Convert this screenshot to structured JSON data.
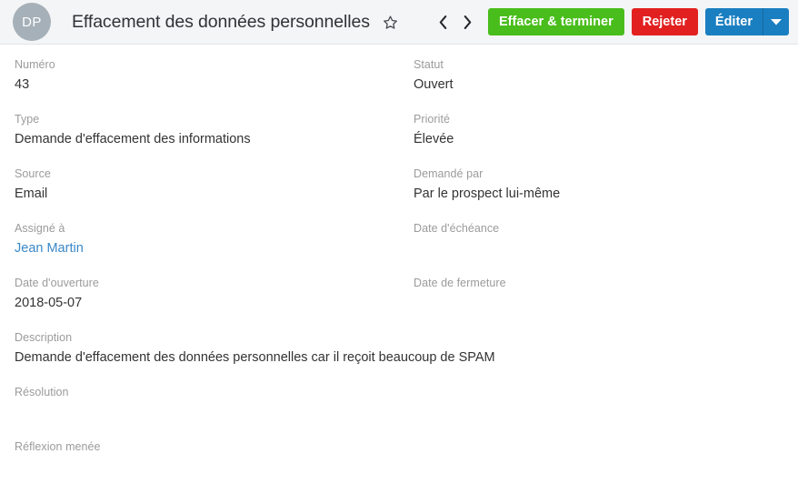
{
  "header": {
    "avatar_initials": "DP",
    "title": "Effacement des données personnelles",
    "star_icon": "star-outline-icon",
    "prev_label": "‹",
    "next_label": "›",
    "buttons": {
      "resolve": "Effacer & terminer",
      "reject": "Rejeter",
      "edit": "Éditer",
      "edit_caret": "chevron-down-icon"
    },
    "colors": {
      "resolve": "#49bd1b",
      "reject": "#e22020",
      "edit": "#1a7fc1",
      "avatar": "#a6b0b8",
      "link": "#3a88c8",
      "bar_bg": "#f4f5f6"
    }
  },
  "fields": [
    {
      "label": "Numéro",
      "value": "43",
      "col": "left",
      "link": false
    },
    {
      "label": "Statut",
      "value": "Ouvert",
      "col": "right",
      "link": false
    },
    {
      "label": "Type",
      "value": "Demande d'effacement des informations",
      "col": "left",
      "link": false
    },
    {
      "label": "Priorité",
      "value": "Élevée",
      "col": "right",
      "link": false
    },
    {
      "label": "Source",
      "value": "Email",
      "col": "left",
      "link": false
    },
    {
      "label": "Demandé par",
      "value": "Par le prospect lui-même",
      "col": "right",
      "link": false
    },
    {
      "label": "Assigné à",
      "value": "Jean Martin",
      "col": "left",
      "link": true
    },
    {
      "label": "Date d'échéance",
      "value": "",
      "col": "right",
      "link": false
    },
    {
      "label": "Date d'ouverture",
      "value": "2018-05-07",
      "col": "left",
      "link": false
    },
    {
      "label": "Date de fermeture",
      "value": "",
      "col": "right",
      "link": false
    },
    {
      "label": "Description",
      "value": "Demande d'effacement des données personnelles car il reçoit beaucoup de SPAM",
      "col": "full",
      "link": false
    },
    {
      "label": "Résolution",
      "value": "",
      "col": "full",
      "link": false
    },
    {
      "label": "Réflexion menée",
      "value": "",
      "col": "full",
      "link": false
    }
  ]
}
